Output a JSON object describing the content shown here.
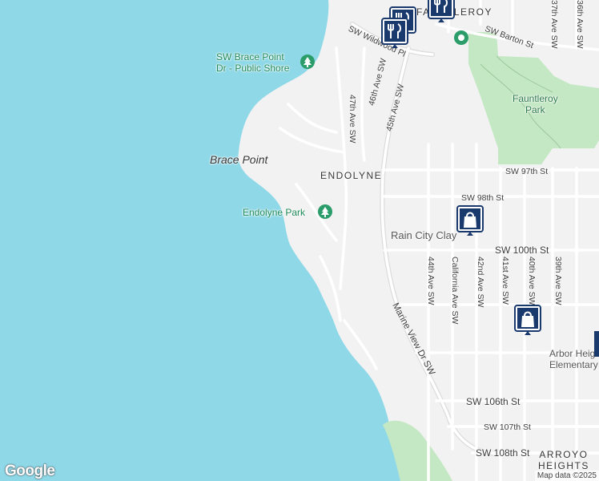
{
  "colors": {
    "water": "#8fd8e8",
    "land": "#f2f2f2",
    "park": "#c4e8c4",
    "road": "#ffffff",
    "road_outline": "#d6d6d6",
    "marker": "#1a3a6e",
    "park_icon": "#2a9d6a"
  },
  "places": {
    "brace_point_shore": "SW Brace Point Dr - Public Shore",
    "brace_point_shore_line1": "SW Brace Point",
    "brace_point_shore_line2": "Dr - Public Shore",
    "brace_point": "Brace Point",
    "endolyne_park": "Endolyne Park",
    "fauntleroy_park_line1": "Fauntleroy",
    "fauntleroy_park_line2": "Park",
    "rain_city_clay": "Rain City Clay",
    "arbor_heights_line1": "Arbor Heights",
    "arbor_heights_line2": "Elementary School",
    "fauntleroy_top": "FAUNTLEROY"
  },
  "neighborhoods": {
    "endolyne": "ENDOLYNE",
    "arroyo_line1": "ARROYO",
    "arroyo_line2": "HEIGHTS"
  },
  "roads": {
    "sw_wildwood_pl": "SW Wildwood Pl",
    "sw_barton_st": "SW Barton St",
    "ave_47th": "47th Ave SW",
    "ave_46th": "46th Ave SW",
    "ave_45th": "45th Ave SW",
    "sw_97th": "SW 97th St",
    "sw_98th": "SW 98th St",
    "sw_100th": "SW 100th St",
    "ave_44th": "44th Ave SW",
    "california": "California Ave SW",
    "ave_42nd": "42nd Ave SW",
    "ave_41st": "41st Ave SW",
    "ave_40th": "40th Ave SW",
    "ave_39th": "39th Ave SW",
    "marine_view": "Marine View Dr SW",
    "sw_106th": "SW 106th St",
    "sw_107th": "SW 107th St",
    "sw_108th": "SW 108th St",
    "ave_37th_top": "37th Ave SW",
    "ave_36th_top": "36th Ave SW"
  },
  "markers": {
    "restaurant_icon": "fork-knife-icon",
    "shopping_icon": "shopping-bag-icon",
    "park_icon": "tree-icon"
  },
  "footer": {
    "logo": "Google",
    "attribution": "Map data ©2025"
  }
}
